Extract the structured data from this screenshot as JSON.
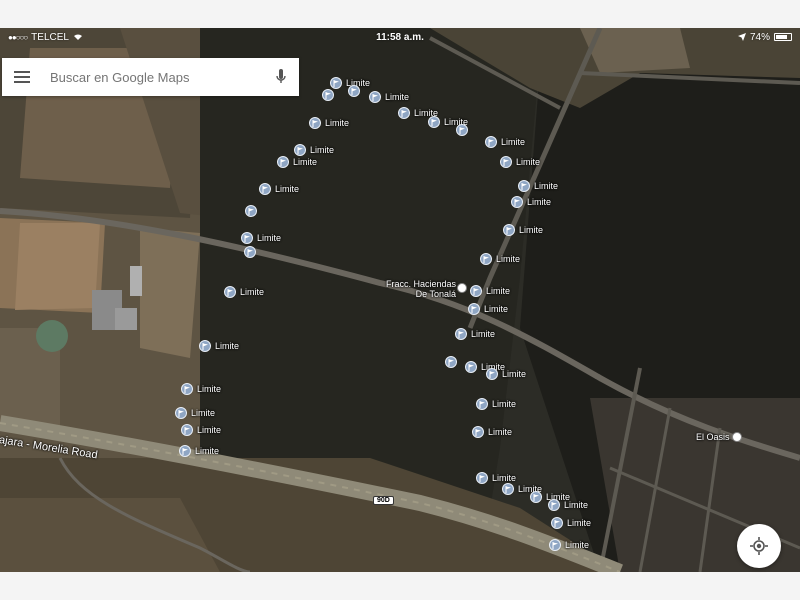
{
  "status_bar": {
    "carrier": "TELCEL",
    "time": "11:58 a.m.",
    "battery": "74%"
  },
  "search": {
    "placeholder": "Buscar en Google Maps",
    "menu_icon": "menu-icon",
    "mic_icon": "microphone-icon"
  },
  "map": {
    "type": "satellite",
    "marker_label": "Limite",
    "markers": [
      {
        "label": "Limite"
      },
      {
        "label": ""
      },
      {
        "label": ""
      },
      {
        "label": "Limite"
      },
      {
        "label": "Limite"
      },
      {
        "label": "Limite"
      },
      {
        "label": ""
      },
      {
        "label": "Limite"
      },
      {
        "label": "Limite"
      },
      {
        "label": "Limite"
      },
      {
        "label": "Limite"
      },
      {
        "label": "Limite"
      },
      {
        "label": "Limite"
      },
      {
        "label": "Limite"
      },
      {
        "label": "Limite"
      },
      {
        "label": "Limite"
      },
      {
        "label": ""
      },
      {
        "label": "Limite"
      },
      {
        "label": "Limite"
      },
      {
        "label": "Limite"
      },
      {
        "label": "Limite"
      },
      {
        "label": "Limite"
      },
      {
        "label": "Limite"
      },
      {
        "label": "Limite"
      },
      {
        "label": "Limite"
      },
      {
        "label": "Limite"
      },
      {
        "label": "Limite"
      },
      {
        "label": "Limite"
      },
      {
        "label": "Limite"
      },
      {
        "label": "Limite"
      },
      {
        "label": "Limite"
      },
      {
        "label": ""
      },
      {
        "label": "Limite"
      },
      {
        "label": ""
      },
      {
        "label": "Limite"
      },
      {
        "label": "Limite"
      },
      {
        "label": "Limite"
      },
      {
        "label": "Limite"
      },
      {
        "label": "Limite"
      },
      {
        "label": "Limite"
      },
      {
        "label": ""
      },
      {
        "label": ""
      },
      {
        "label": "Limite"
      },
      {
        "label": "Limite"
      },
      {
        "label": "Limite"
      },
      {
        "label": "Limite"
      }
    ],
    "places": {
      "fracc_line1": "Fracc. Haciendas",
      "fracc_line2": "De Tonalá",
      "oasis": "El Oasis"
    },
    "roads": {
      "highway": "ajara - Morelia Road",
      "route_shield": "90D"
    }
  },
  "colors": {
    "marker": "#8fa6c4",
    "terrain_dark": "#2c2c26",
    "field": "#7a6a55"
  }
}
